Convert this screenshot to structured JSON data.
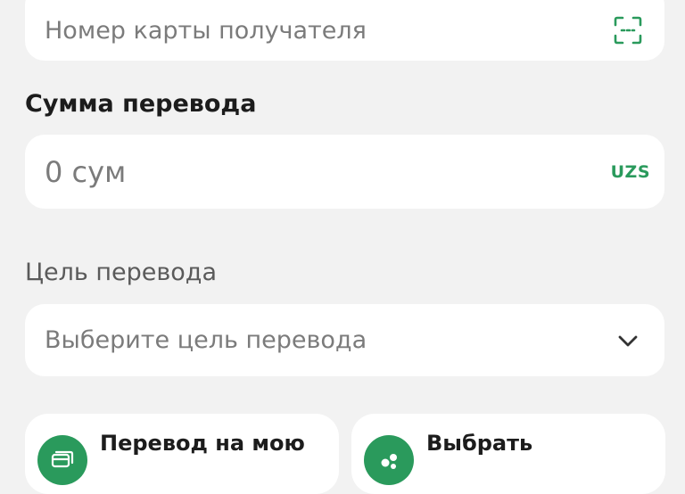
{
  "card_field": {
    "placeholder": "Номер карты получателя",
    "scan_icon": "scan-qr-icon"
  },
  "amount": {
    "label": "Сумма перевода",
    "value": "0 сум",
    "currency": "UZS"
  },
  "purpose": {
    "label": "Цель перевода",
    "placeholder": "Выберите цель перевода",
    "chevron_icon": "chevron-down-icon"
  },
  "actions": [
    {
      "label": "Перевод на мою",
      "icon": "cards-icon"
    },
    {
      "label": "Выбрать",
      "icon": "contacts-icon"
    }
  ],
  "colors": {
    "accent": "#2a9a5c",
    "background": "#f2f2f2",
    "field": "#ffffff",
    "placeholder": "#7b7b7b"
  }
}
